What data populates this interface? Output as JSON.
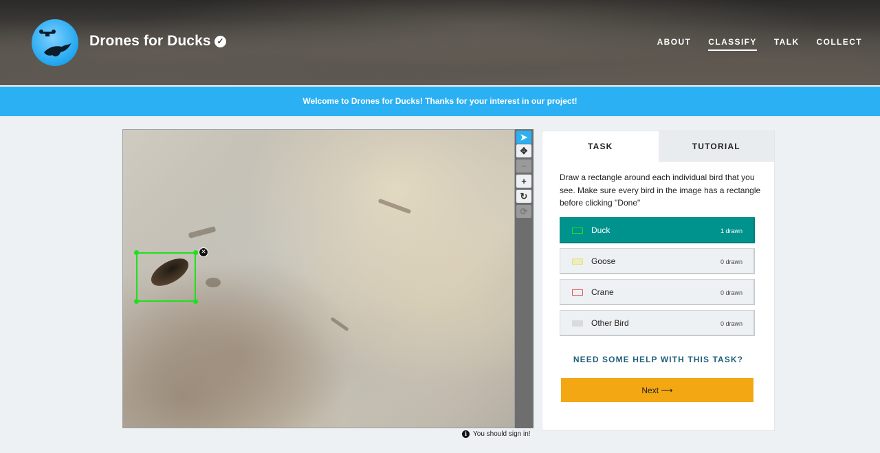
{
  "header": {
    "project_title": "Drones for Ducks",
    "verified_icon": "check-circle-icon",
    "nav": [
      "ABOUT",
      "CLASSIFY",
      "TALK",
      "COLLECT"
    ],
    "active_nav": "CLASSIFY"
  },
  "banner": {
    "text": "Welcome to Drones for Ducks! Thanks for your interest in our project!"
  },
  "viewer": {
    "tools": [
      "pointer-icon",
      "move-icon",
      "zoom-out-icon",
      "zoom-in-icon",
      "rotate-icon",
      "reset-icon"
    ],
    "sign_in_notice": "You should sign in!"
  },
  "task_panel": {
    "tabs": [
      "TASK",
      "TUTORIAL"
    ],
    "instructions": "Draw a rectangle around each individual bird that you see. Make sure every bird in the image has a rectangle before clicking \"Done\"",
    "answers": [
      {
        "label": "Duck",
        "count": "1 drawn",
        "color": "#1ee01e",
        "selected": true
      },
      {
        "label": "Goose",
        "count": "0 drawn",
        "color": "#e8e36a",
        "selected": false
      },
      {
        "label": "Crane",
        "count": "0 drawn",
        "color": "#e05555",
        "selected": false
      },
      {
        "label": "Other Bird",
        "count": "0 drawn",
        "color": "#d8dadc",
        "selected": false
      }
    ],
    "help_link": "NEED SOME HELP WITH THIS TASK?",
    "next_button": "Next ⟶"
  },
  "colors": {
    "banner": "#2bb1f3",
    "selected_answer": "#00938e",
    "next_button": "#f3a712"
  }
}
